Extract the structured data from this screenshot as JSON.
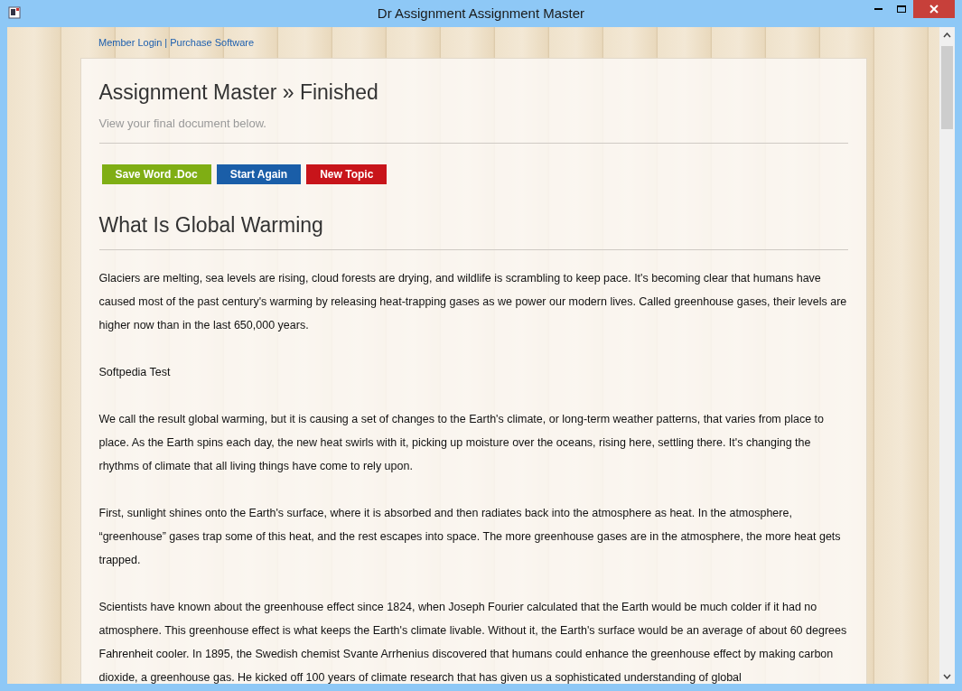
{
  "window": {
    "title": "Dr Assignment Assignment Master"
  },
  "top_links": [
    "Member Login",
    "Purchase Software"
  ],
  "link_separator": "|",
  "page": {
    "title": "Assignment Master » Finished",
    "subtitle": "View your final document below."
  },
  "buttons": [
    {
      "label": "Save Word .Doc",
      "color": "#7fae14"
    },
    {
      "label": "Start Again",
      "color": "#1a5ea8"
    },
    {
      "label": "New Topic",
      "color": "#c8141a"
    }
  ],
  "article": {
    "title": "What Is Global Warming",
    "paragraphs": [
      "Glaciers are melting, sea levels are rising, cloud forests are drying, and wildlife is scrambling to keep pace. It's becoming clear that humans have caused most of the past century's warming by releasing heat-trapping gases as we power our modern lives. Called greenhouse gases, their levels are higher now than in the last 650,000 years.",
      "Softpedia Test",
      "We call the result global warming, but it is causing a set of changes to the Earth's climate, or long-term weather patterns, that varies from place to place. As the Earth spins each day, the new heat swirls with it, picking up moisture over the oceans, rising here, settling there. It's changing the rhythms of climate that all living things have come to rely upon.",
      "First, sunlight shines onto the Earth's surface, where it is absorbed and then radiates back into the atmosphere as heat. In the atmosphere, “greenhouse” gases trap some of this heat, and the rest escapes into space. The more greenhouse gases are in the atmosphere, the more heat gets trapped.",
      "Scientists have known about the greenhouse effect since 1824, when Joseph Fourier calculated that the Earth would be much colder if it had no atmosphere. This greenhouse effect is what keeps the Earth's climate livable. Without it, the Earth's surface would be an average of about 60 degrees Fahrenheit cooler. In 1895, the Swedish chemist Svante Arrhenius discovered that humans could enhance the greenhouse effect by making carbon dioxide, a greenhouse gas. He kicked off 100 years of climate research that has given us a sophisticated understanding of global"
    ]
  }
}
